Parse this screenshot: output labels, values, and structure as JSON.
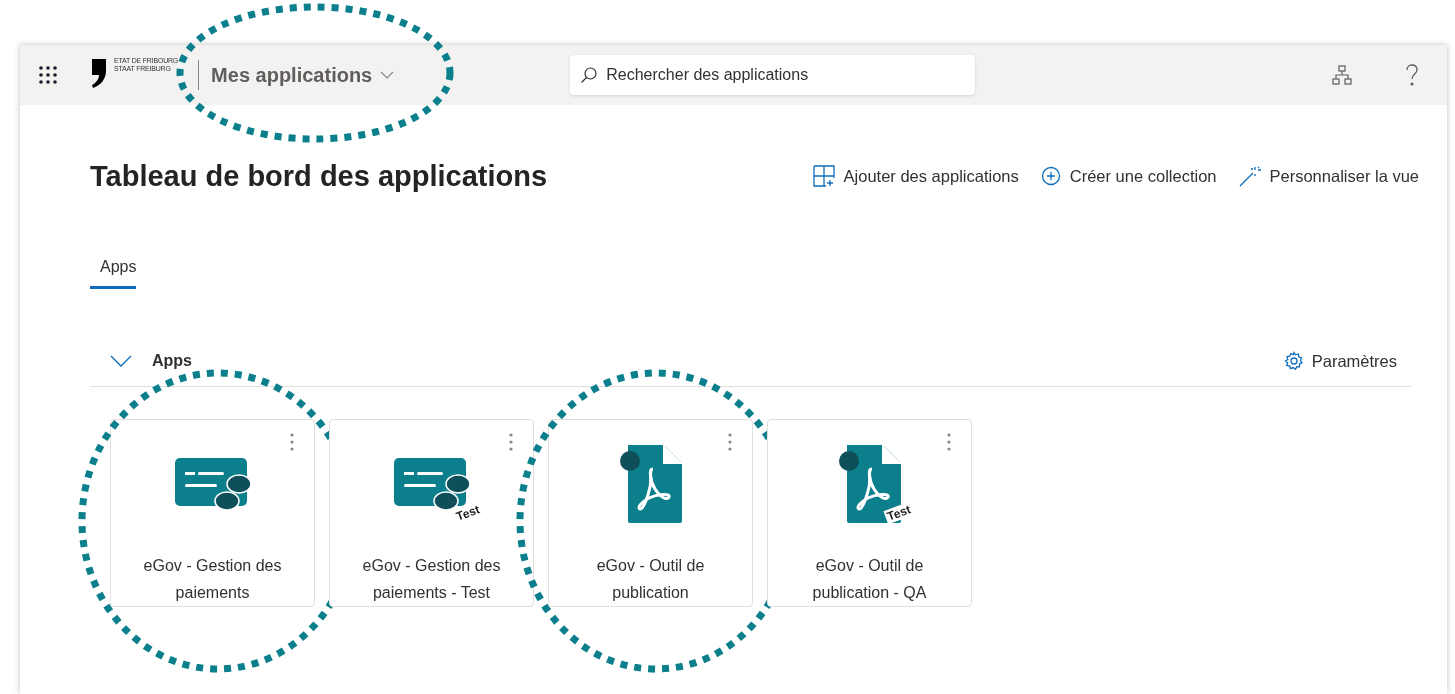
{
  "header": {
    "logo_lines": [
      "ETAT DE FRIBOURG",
      "STAAT FREIBURG"
    ],
    "app_title": "Mes applications",
    "app_title_highlighted": true,
    "search": {
      "placeholder": "Rechercher des applications"
    }
  },
  "page_title": "Tableau de bord des applications",
  "actions": [
    {
      "kind": "add",
      "label": "Ajouter des applications"
    },
    {
      "kind": "collection",
      "label": "Créer une collection"
    },
    {
      "kind": "customize",
      "label": "Personnaliser la vue"
    }
  ],
  "tabs": [
    {
      "label": "Apps",
      "selected": true
    }
  ],
  "section": {
    "title": "Apps",
    "expanded": true,
    "settings": "Paramètres"
  },
  "apps": [
    {
      "kind": "payment",
      "label": "eGov - Gestion des paiements",
      "highlighted": true
    },
    {
      "kind": "payment",
      "label": "eGov - Gestion des paiements - Test",
      "badge": "Test",
      "highlighted": false
    },
    {
      "kind": "pdf",
      "label": "eGov - Outil de publication",
      "highlighted": true
    },
    {
      "kind": "pdf",
      "label": "eGov - Outil de publication - QA",
      "badge": "Test",
      "highlighted": false
    }
  ]
}
